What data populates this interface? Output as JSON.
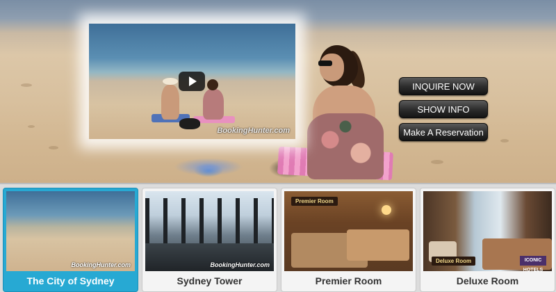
{
  "hero": {
    "video": {
      "watermark": "BookingHunter.com",
      "play_icon": "play-icon"
    },
    "actions": [
      {
        "label": "INQUIRE NOW"
      },
      {
        "label": "SHOW INFO"
      },
      {
        "label": "Make A Reservation"
      }
    ]
  },
  "gallery": {
    "items": [
      {
        "caption": "The City of Sydney",
        "watermark": "BookingHunter.com",
        "active": true
      },
      {
        "caption": "Sydney Tower",
        "watermark": "BookingHunter.com",
        "active": false
      },
      {
        "caption": "Premier Room",
        "tag": "Premier Room",
        "active": false
      },
      {
        "caption": "Deluxe Room",
        "tag": "Deluxe Room",
        "logo": "ICONIC HOTELS",
        "active": false
      }
    ]
  },
  "colors": {
    "active_tab": "#27a9d3",
    "button_dark": "#2e2e2e"
  }
}
